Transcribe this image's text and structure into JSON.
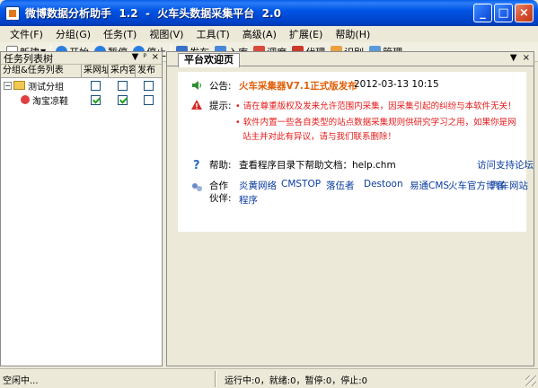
{
  "window": {
    "title": "微博数据分析助手  1.2  -  火车头数据采集平台  2.0",
    "buttons": {
      "minimize": "_",
      "maximize": "□",
      "close": "×"
    }
  },
  "menu": [
    "文件(F)",
    "分组(G)",
    "任务(T)",
    "视图(V)",
    "工具(T)",
    "高级(A)",
    "扩展(E)",
    "帮助(H)"
  ],
  "toolbar": {
    "new": "新建",
    "start": "开始",
    "pause": "暂停",
    "stop": "停止",
    "publish": "发布",
    "import": "入库",
    "schedule": "调度",
    "proxy": "代理",
    "recognize": "识别",
    "manage": "管理"
  },
  "task_panel": {
    "title": "任务列表树",
    "columns": [
      "分组&任务列表",
      "采网址",
      "采内容",
      "发布"
    ],
    "rows": [
      {
        "name": "测试分组",
        "url": false,
        "content": false,
        "publish": false
      },
      {
        "name": "淘宝凉鞋",
        "url": true,
        "content": true,
        "publish": false
      }
    ]
  },
  "welcome": {
    "tab_label": "平台欢迎页",
    "notice_label": "公告:",
    "notice_text": "火车采集器V7.1正式版发布",
    "notice_date": "2012-03-13 10:15",
    "tip_label": "提示:",
    "tip_line1": "• 请在尊重版权及发来允许范围内采集，因采集引起的纠纷与本软件无关！",
    "tip_line2a": "• 软件内置一些各自类型的站点数据采集规则供研究学习之用，如果你是网",
    "tip_line2b": "站主并对此有异议，请与我们联系删除！",
    "help_label": "帮助:",
    "help_text": "查看程序目录下帮助文档：help.chm",
    "help_link": "访问支持论坛",
    "partner_label1": "合作",
    "partner_label2": "伙伴:",
    "partners": [
      "炎黄网络",
      "CMSTOP",
      "落伍者",
      "Destoon",
      "易通CMS",
      "火车官方博客",
      "汽车网站",
      "程序"
    ]
  },
  "status": {
    "left": "空闲中...",
    "counts": "运行中:0，就绪:0，暂停:0，停止:0"
  }
}
